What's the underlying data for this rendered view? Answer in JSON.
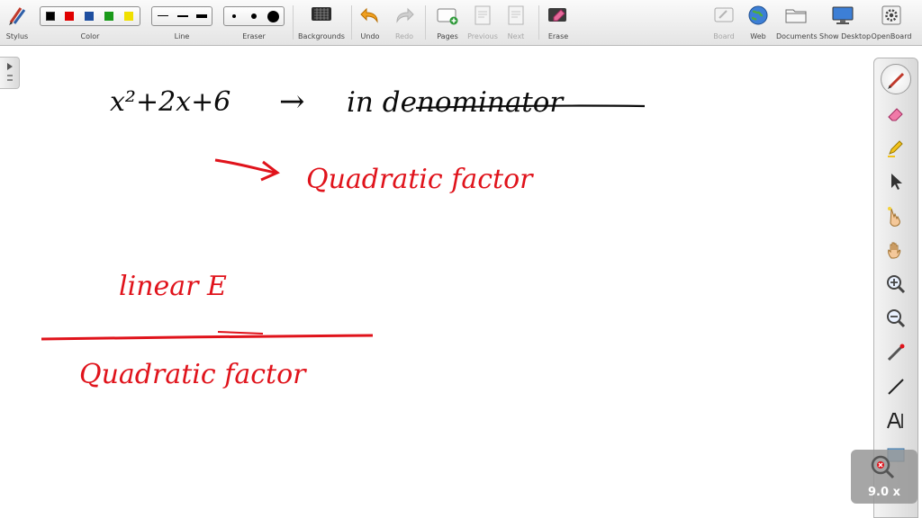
{
  "toolbar": {
    "stylus_label": "Stylus",
    "color_label": "Color",
    "line_label": "Line",
    "eraser_label": "Eraser",
    "backgrounds_label": "Backgrounds",
    "undo_label": "Undo",
    "redo_label": "Redo",
    "pages_label": "Pages",
    "previous_label": "Previous",
    "next_label": "Next",
    "erase_label": "Erase",
    "board_label": "Board",
    "web_label": "Web",
    "documents_label": "Documents",
    "show_desktop_label": "Show Desktop",
    "openboard_label": "OpenBoard",
    "colors": [
      "#000000",
      "#e00000",
      "#1f4fa0",
      "#1a9a1a",
      "#f0e000"
    ]
  },
  "canvas": {
    "line1_expr": "x²+2x+6",
    "line1_arrow": "→",
    "line1_note": "in denominator",
    "line2_arrow": "→",
    "line2_note": "Quadratic factor",
    "fraction_numerator": "linear E",
    "fraction_denominator": "Quadratic factor",
    "ink_black": "#0c0c0c",
    "ink_red": "#e0131b"
  },
  "zoom": {
    "level": "9.0 x"
  }
}
